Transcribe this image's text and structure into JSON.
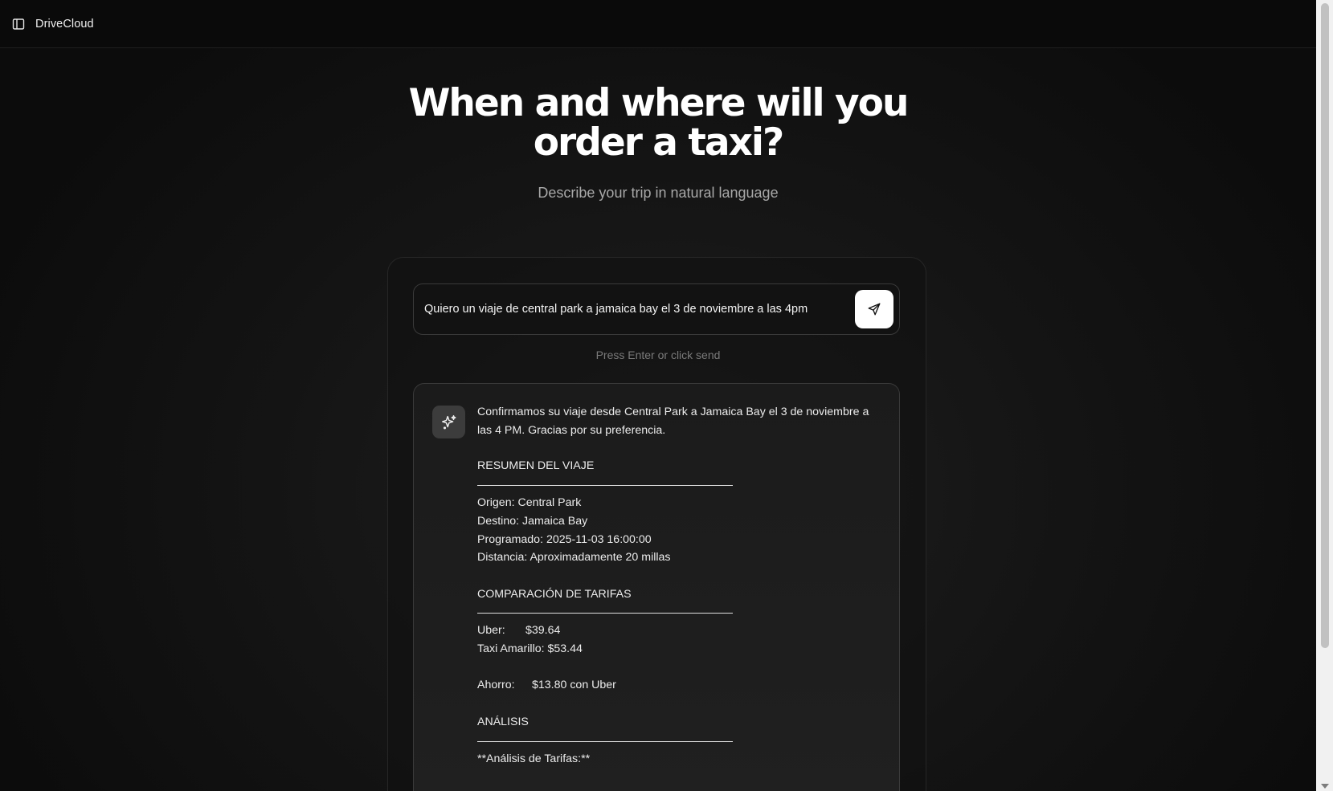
{
  "header": {
    "brand": "DriveCloud",
    "sidebar_toggle_icon": "sidebar-toggle-icon"
  },
  "hero": {
    "title_line1": "When and where will you",
    "title_line2": "order a taxi?",
    "subtitle": "Describe your trip in natural language"
  },
  "prompt": {
    "value": "Quiero un viaje de central park a jamaica bay el 3 de noviembre a las 4pm",
    "send_icon": "send-icon",
    "hint": "Press Enter or click send"
  },
  "response": {
    "avatar_icon": "sparkles-icon",
    "intro": "Confirmamos su viaje desde Central Park a Jamaica Bay el 3 de noviembre a las 4 PM.  Gracias por su preferencia.",
    "summary": {
      "title": "RESUMEN DEL VIAJE",
      "origin": "Origen: Central Park",
      "destination": "Destino: Jamaica Bay",
      "scheduled": "Programado: 2025-11-03 16:00:00",
      "distance": "Distancia: Aproximadamente 20 millas"
    },
    "fares": {
      "title": "COMPARACIÓN DE TARIFAS",
      "uber_label": "Uber:",
      "uber_value": "$39.64",
      "taxi_row": "Taxi Amarillo: $53.44",
      "savings_label": "Ahorro:",
      "savings_value": "$13.80 con Uber"
    },
    "analysis": {
      "title": "ANÁLISIS",
      "subtitle": "**Análisis de Tarifas:**"
    }
  },
  "colors": {
    "background": "#0c0c0c",
    "card": "#1e1e1e",
    "accent_button": "#ffffff"
  }
}
